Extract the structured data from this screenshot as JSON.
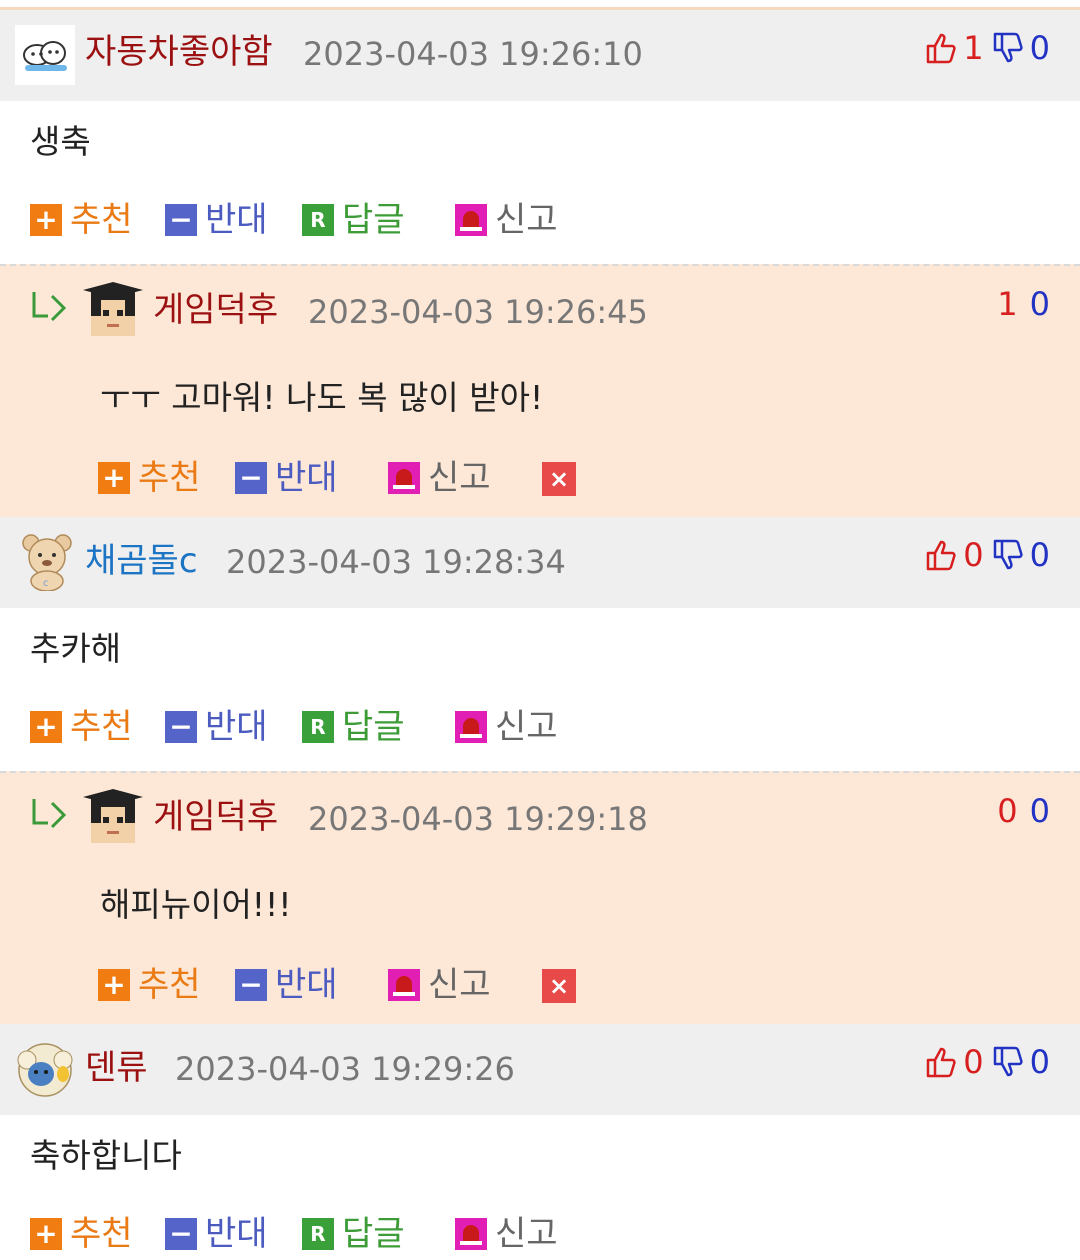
{
  "colors": {
    "header_bg": "#efefef",
    "reply_bg": "#fde8d7",
    "nick_red": "#9b1111",
    "nick_blue": "#1c74c4",
    "up_red": "#d81f1f",
    "down_blue": "#2233c4"
  },
  "actions": {
    "recommend": "추천",
    "oppose": "반대",
    "reply": "답글",
    "report": "신고",
    "delete_icon": "close-icon"
  },
  "comments": [
    {
      "nickname": "자동차좋아함",
      "datetime": "2023-04-03 19:26:10",
      "up": "1",
      "down": "0",
      "text": "생축",
      "avatar_icon": "cloud-avatar-icon"
    },
    {
      "nickname": "게임덕후",
      "datetime": "2023-04-03 19:26:45",
      "up": "1",
      "down": "0",
      "text": "ㅜㅜ 고마워! 나도 복 많이 받아!",
      "avatar_icon": "graduate-avatar-icon"
    },
    {
      "nickname": "채곰돌c",
      "datetime": "2023-04-03 19:28:34",
      "up": "0",
      "down": "0",
      "text": "추카해",
      "avatar_icon": "bear-avatar-icon"
    },
    {
      "nickname": "게임덕후",
      "datetime": "2023-04-03 19:29:18",
      "up": "0",
      "down": "0",
      "text": "해피뉴이어!!!",
      "avatar_icon": "graduate-avatar-icon"
    },
    {
      "nickname": "덴류",
      "datetime": "2023-04-03 19:29:26",
      "up": "0",
      "down": "0",
      "text": "축하합니다",
      "avatar_icon": "sheep-avatar-icon"
    }
  ]
}
